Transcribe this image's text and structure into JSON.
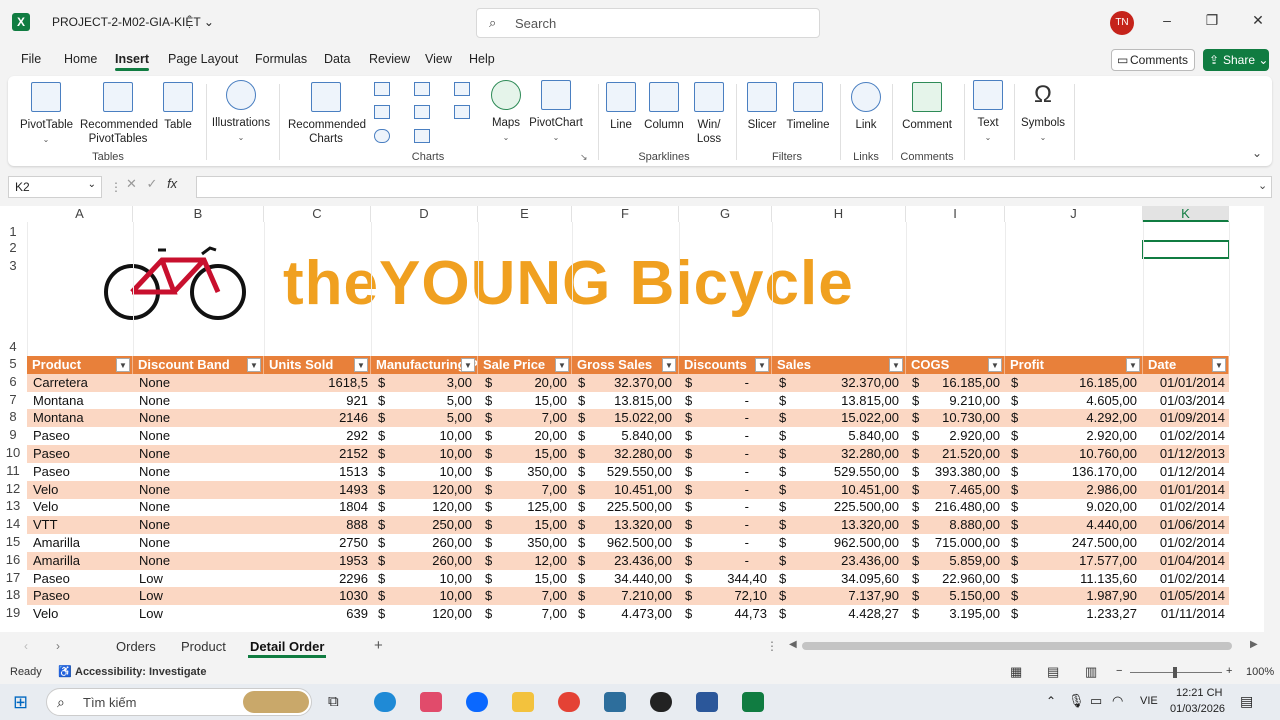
{
  "window": {
    "title": "PROJECT-2-M02-GIA-KIỆT",
    "search_placeholder": "Search",
    "avatar": "TN",
    "minimize": "–",
    "maximize": "❐",
    "close": "✕"
  },
  "menu": {
    "tabs": [
      "File",
      "Home",
      "Insert",
      "Page Layout",
      "Formulas",
      "Data",
      "Review",
      "View",
      "Help"
    ],
    "active": "Insert",
    "comments": "Comments",
    "share": "Share"
  },
  "ribbon": {
    "tables": {
      "pivottable": "PivotTable",
      "recommended_pivot": "Recommended PivotTables",
      "table": "Table",
      "label": "Tables"
    },
    "illustrations": "Illustrations",
    "charts": {
      "recommended": "Recommended Charts",
      "maps": "Maps",
      "pivotchart": "PivotChart",
      "label": "Charts"
    },
    "sparklines": {
      "line": "Line",
      "column": "Column",
      "winloss": "Win/ Loss",
      "label": "Sparklines"
    },
    "filters": {
      "slicer": "Slicer",
      "timeline": "Timeline",
      "label": "Filters"
    },
    "links": {
      "link": "Link",
      "label": "Links"
    },
    "comments": {
      "comment": "Comment",
      "label": "Comments"
    },
    "text": "Text",
    "symbols": "Symbols"
  },
  "formula_bar": {
    "name_box": "K2",
    "fx": "fx",
    "formula": ""
  },
  "sheet": {
    "columns": [
      "A",
      "B",
      "C",
      "D",
      "E",
      "F",
      "G",
      "H",
      "I",
      "J",
      "K"
    ],
    "selected_column": "K",
    "logo_text": "theYOUNG Bicycle",
    "headers": [
      "Product",
      "Discount Band",
      "Units Sold",
      "Manufacturing Price",
      "Sale Price",
      "Gross Sales",
      "Discounts",
      "Sales",
      "COGS",
      "Profit",
      "Date"
    ],
    "rows": [
      [
        "6",
        "Carretera",
        "None",
        "1618,5",
        "$",
        "3,00",
        "$",
        "20,00",
        "$",
        "32.370,00",
        "$",
        "-",
        "$",
        "32.370,00",
        "$",
        "16.185,00",
        "$",
        "16.185,00",
        "01/01/2014"
      ],
      [
        "7",
        "Montana",
        "None",
        "921",
        "$",
        "5,00",
        "$",
        "15,00",
        "$",
        "13.815,00",
        "$",
        "-",
        "$",
        "13.815,00",
        "$",
        "9.210,00",
        "$",
        "4.605,00",
        "01/03/2014"
      ],
      [
        "8",
        "Montana",
        "None",
        "2146",
        "$",
        "5,00",
        "$",
        "7,00",
        "$",
        "15.022,00",
        "$",
        "-",
        "$",
        "15.022,00",
        "$",
        "10.730,00",
        "$",
        "4.292,00",
        "01/09/2014"
      ],
      [
        "9",
        "Paseo",
        "None",
        "292",
        "$",
        "10,00",
        "$",
        "20,00",
        "$",
        "5.840,00",
        "$",
        "-",
        "$",
        "5.840,00",
        "$",
        "2.920,00",
        "$",
        "2.920,00",
        "01/02/2014"
      ],
      [
        "10",
        "Paseo",
        "None",
        "2152",
        "$",
        "10,00",
        "$",
        "15,00",
        "$",
        "32.280,00",
        "$",
        "-",
        "$",
        "32.280,00",
        "$",
        "21.520,00",
        "$",
        "10.760,00",
        "01/12/2013"
      ],
      [
        "11",
        "Paseo",
        "None",
        "1513",
        "$",
        "10,00",
        "$",
        "350,00",
        "$",
        "529.550,00",
        "$",
        "-",
        "$",
        "529.550,00",
        "$",
        "393.380,00",
        "$",
        "136.170,00",
        "01/12/2014"
      ],
      [
        "12",
        "Velo",
        "None",
        "1493",
        "$",
        "120,00",
        "$",
        "7,00",
        "$",
        "10.451,00",
        "$",
        "-",
        "$",
        "10.451,00",
        "$",
        "7.465,00",
        "$",
        "2.986,00",
        "01/01/2014"
      ],
      [
        "13",
        "Velo",
        "None",
        "1804",
        "$",
        "120,00",
        "$",
        "125,00",
        "$",
        "225.500,00",
        "$",
        "-",
        "$",
        "225.500,00",
        "$",
        "216.480,00",
        "$",
        "9.020,00",
        "01/02/2014"
      ],
      [
        "14",
        "VTT",
        "None",
        "888",
        "$",
        "250,00",
        "$",
        "15,00",
        "$",
        "13.320,00",
        "$",
        "-",
        "$",
        "13.320,00",
        "$",
        "8.880,00",
        "$",
        "4.440,00",
        "01/06/2014"
      ],
      [
        "15",
        "Amarilla",
        "None",
        "2750",
        "$",
        "260,00",
        "$",
        "350,00",
        "$",
        "962.500,00",
        "$",
        "-",
        "$",
        "962.500,00",
        "$",
        "715.000,00",
        "$",
        "247.500,00",
        "01/02/2014"
      ],
      [
        "16",
        "Amarilla",
        "None",
        "1953",
        "$",
        "260,00",
        "$",
        "12,00",
        "$",
        "23.436,00",
        "$",
        "-",
        "$",
        "23.436,00",
        "$",
        "5.859,00",
        "$",
        "17.577,00",
        "01/04/2014"
      ],
      [
        "17",
        "Paseo",
        "Low",
        "2296",
        "$",
        "10,00",
        "$",
        "15,00",
        "$",
        "34.440,00",
        "$",
        "344,40",
        "$",
        "34.095,60",
        "$",
        "22.960,00",
        "$",
        "11.135,60",
        "01/02/2014"
      ],
      [
        "18",
        "Paseo",
        "Low",
        "1030",
        "$",
        "10,00",
        "$",
        "7,00",
        "$",
        "7.210,00",
        "$",
        "72,10",
        "$",
        "7.137,90",
        "$",
        "5.150,00",
        "$",
        "1.987,90",
        "01/05/2014"
      ],
      [
        "19",
        "Velo",
        "Low",
        "639",
        "$",
        "120,00",
        "$",
        "7,00",
        "$",
        "4.473,00",
        "$",
        "44,73",
        "$",
        "4.428,27",
        "$",
        "3.195,00",
        "$",
        "1.233,27",
        "01/11/2014"
      ]
    ]
  },
  "sheet_tabs": [
    "Orders",
    "Product",
    "Detail Order"
  ],
  "active_sheet": "Detail Order",
  "status": {
    "ready": "Ready",
    "accessibility": "Accessibility: Investigate",
    "zoom": "100%"
  },
  "taskbar": {
    "search_placeholder": "Tìm kiếm",
    "lang": "VIE",
    "time": "12:21 CH",
    "date": "01/03/2026"
  }
}
